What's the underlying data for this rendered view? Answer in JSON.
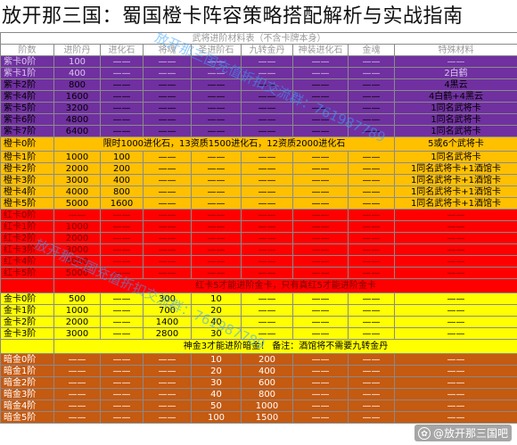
{
  "title": "放开那三国：蜀国橙卡阵容策略搭配解析与实战指南",
  "header_caption": "武将进阶材料表（不含卡牌本身）",
  "columns": [
    "阶数",
    "进阶丹",
    "进化石",
    "将魂",
    "圣进阶石",
    "九转金丹",
    "神装进化石",
    "金魂",
    "特殊材料"
  ],
  "rows": [
    {
      "kind": "data",
      "cells": [
        "紫卡0阶",
        "100",
        "——",
        "——",
        "——",
        "——",
        "——",
        "——",
        "——"
      ],
      "bg": "#7030A0",
      "fg": "#d9c6ec"
    },
    {
      "kind": "data",
      "cells": [
        "紫卡1阶",
        "400",
        "——",
        "——",
        "——",
        "——",
        "——",
        "——",
        "2白鹤"
      ],
      "bg": "#7030A0",
      "fg": "#d9c6ec"
    },
    {
      "kind": "data",
      "cells": [
        "紫卡2阶",
        "800",
        "——",
        "——",
        "——",
        "——",
        "——",
        "——",
        "4黑云"
      ],
      "bg": "#7030A0",
      "fg": "#000000"
    },
    {
      "kind": "data",
      "cells": [
        "紫卡4阶",
        "1600",
        "——",
        "——",
        "——",
        "——",
        "——",
        "——",
        "4白鹤+4黑云"
      ],
      "bg": "#7030A0",
      "fg": "#000000"
    },
    {
      "kind": "data",
      "cells": [
        "紫卡5阶",
        "3200",
        "——",
        "——",
        "——",
        "——",
        "——",
        "——",
        "1同名武将卡"
      ],
      "bg": "#7030A0",
      "fg": "#000000"
    },
    {
      "kind": "data",
      "cells": [
        "紫卡6阶",
        "4800",
        "——",
        "——",
        "——",
        "——",
        "——",
        "——",
        "1同名武将卡"
      ],
      "bg": "#7030A0",
      "fg": "#000000"
    },
    {
      "kind": "data",
      "cells": [
        "紫卡7阶",
        "6400",
        "——",
        "——",
        "——",
        "——",
        "——",
        "——",
        "1同名武将卡"
      ],
      "bg": "#7030A0",
      "fg": "#000000"
    },
    {
      "kind": "note",
      "label": "橙卡0阶",
      "text": "限时1000进化石，13资质1500进化石，12资质2000进化石",
      "tail": "5或6个武将卡",
      "bg": "#FFC000",
      "fg": "#000000"
    },
    {
      "kind": "data",
      "cells": [
        "橙卡1阶",
        "1000",
        "100",
        "——",
        "——",
        "——",
        "——",
        "——",
        "1同名武将卡"
      ],
      "bg": "#FFC000",
      "fg": "#000000"
    },
    {
      "kind": "data",
      "cells": [
        "橙卡2阶",
        "2000",
        "200",
        "——",
        "——",
        "——",
        "——",
        "——",
        "1同名武将卡+1酒馆卡"
      ],
      "bg": "#FFC000",
      "fg": "#000000"
    },
    {
      "kind": "data",
      "cells": [
        "橙卡3阶",
        "3000",
        "400",
        "——",
        "——",
        "——",
        "——",
        "——",
        "1同名武将卡+1酒馆卡"
      ],
      "bg": "#FFC000",
      "fg": "#000000"
    },
    {
      "kind": "data",
      "cells": [
        "橙卡4阶",
        "4000",
        "800",
        "——",
        "——",
        "——",
        "——",
        "——",
        "1同名武将卡+1酒馆卡"
      ],
      "bg": "#FFC000",
      "fg": "#000000"
    },
    {
      "kind": "data",
      "cells": [
        "橙卡5阶",
        "5000",
        "1600",
        "——",
        "——",
        "——",
        "——",
        "——",
        "1同名武将卡+1酒馆卡"
      ],
      "bg": "#FFC000",
      "fg": "#000000"
    },
    {
      "kind": "data",
      "cells": [
        "红卡0阶",
        "——",
        "——",
        "——",
        "——",
        "——",
        "——",
        "——",
        "——"
      ],
      "bg": "#FF0000",
      "fg": "#7a0000"
    },
    {
      "kind": "data",
      "cells": [
        "红卡1阶",
        "1000",
        "——",
        "——",
        "——",
        "——",
        "——",
        "——",
        "——"
      ],
      "bg": "#FF0000",
      "fg": "#7a0000"
    },
    {
      "kind": "data",
      "cells": [
        "红卡2阶",
        "2000",
        "——",
        "——",
        "——",
        "——",
        "——",
        "——",
        "——"
      ],
      "bg": "#FF0000",
      "fg": "#7a0000"
    },
    {
      "kind": "data",
      "cells": [
        "红卡3阶",
        "3000",
        "——",
        "——",
        "——",
        "——",
        "——",
        "——",
        "——"
      ],
      "bg": "#FF0000",
      "fg": "#7a0000"
    },
    {
      "kind": "data",
      "cells": [
        "红卡4阶",
        "4000",
        "——",
        "——",
        "——",
        "——",
        "——",
        "——",
        "——"
      ],
      "bg": "#FF0000",
      "fg": "#7a0000"
    },
    {
      "kind": "data",
      "cells": [
        "红卡5阶",
        "5000",
        "——",
        "——",
        "——",
        "——",
        "——",
        "——",
        "——"
      ],
      "bg": "#FF0000",
      "fg": "#7a0000"
    },
    {
      "kind": "note",
      "label": "",
      "text": "红卡5才能进阶金卡，只有真红5才能进阶金卡",
      "tail": "",
      "bg": "#FF0000",
      "fg": "#7a0000"
    },
    {
      "kind": "data",
      "cells": [
        "金卡0阶",
        "500",
        "——",
        "300",
        "10",
        "——",
        "——",
        "——",
        "——"
      ],
      "bg": "#FFFF00",
      "fg": "#000000"
    },
    {
      "kind": "data",
      "cells": [
        "金卡1阶",
        "1000",
        "——",
        "700",
        "20",
        "——",
        "——",
        "——",
        "——"
      ],
      "bg": "#FFFF00",
      "fg": "#000000"
    },
    {
      "kind": "data",
      "cells": [
        "金卡2阶",
        "2000",
        "——",
        "1400",
        "40",
        "——",
        "——",
        "——",
        "——"
      ],
      "bg": "#FFFF00",
      "fg": "#000000"
    },
    {
      "kind": "data",
      "cells": [
        "金卡3阶",
        "3000",
        "——",
        "2800",
        "30",
        "——",
        "——",
        "——",
        "——"
      ],
      "bg": "#FFFF00",
      "fg": "#000000"
    },
    {
      "kind": "note",
      "label": "",
      "text": "神金3才能进阶暗金！ 备注：酒馆将不需要九转金丹",
      "tail": "",
      "bg": "#FFFF00",
      "fg": "#000000"
    },
    {
      "kind": "data",
      "cells": [
        "暗金0阶",
        "——",
        "——",
        "——",
        "10",
        "200",
        "——",
        "——",
        "——"
      ],
      "bg": "#C55A11",
      "fg": "#ffffff"
    },
    {
      "kind": "data",
      "cells": [
        "暗金1阶",
        "——",
        "——",
        "——",
        "20",
        "400",
        "——",
        "——",
        "——"
      ],
      "bg": "#C55A11",
      "fg": "#ffffff"
    },
    {
      "kind": "data",
      "cells": [
        "暗金2阶",
        "——",
        "——",
        "——",
        "30",
        "600",
        "——",
        "——",
        "——"
      ],
      "bg": "#C55A11",
      "fg": "#ffffff"
    },
    {
      "kind": "data",
      "cells": [
        "暗金3阶",
        "——",
        "——",
        "——",
        "40",
        "800",
        "——",
        "——",
        "——"
      ],
      "bg": "#C55A11",
      "fg": "#ffffff"
    },
    {
      "kind": "data",
      "cells": [
        "暗金4阶",
        "——",
        "——",
        "——",
        "50",
        "1000",
        "——",
        "——",
        "——"
      ],
      "bg": "#C55A11",
      "fg": "#ffffff"
    },
    {
      "kind": "data",
      "cells": [
        "暗金5阶",
        "——",
        "——",
        "——",
        "100",
        "1500",
        "——",
        "——",
        "——"
      ],
      "bg": "#C55A11",
      "fg": "#ffffff"
    }
  ],
  "watermark_1": "放开那三国充值折扣交流群：761987789",
  "watermark_2": "放开那三国充值折扣交流群：761987789",
  "brand_label": "@放开那三国吧",
  "brand_icon": "paw-logo-icon"
}
